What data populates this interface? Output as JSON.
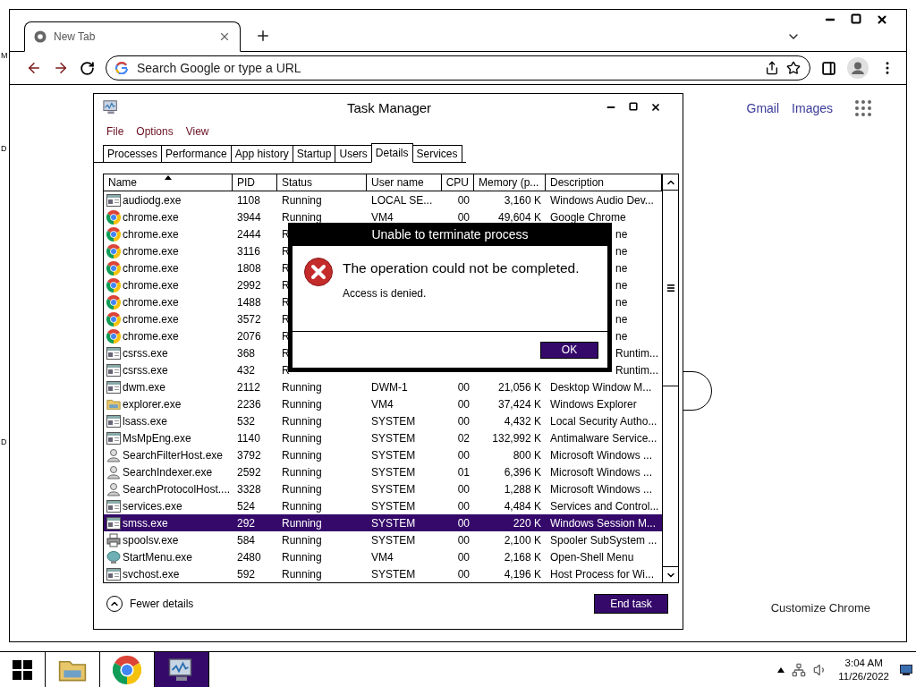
{
  "desktop": {
    "labels": [
      "M",
      "D",
      "D"
    ]
  },
  "browser": {
    "tabs": [
      {
        "title": "New Tab",
        "selected": true
      }
    ],
    "omnibox": {
      "placeholder": "Search Google or type a URL"
    },
    "links": [
      "Gmail",
      "Images"
    ],
    "customize": "Customize Chrome"
  },
  "task_manager": {
    "title": "Task Manager",
    "menu": [
      "File",
      "Options",
      "View"
    ],
    "tabs": [
      {
        "label": "Processes",
        "selected": false
      },
      {
        "label": "Performance",
        "selected": false
      },
      {
        "label": "App history",
        "selected": false
      },
      {
        "label": "Startup",
        "selected": false
      },
      {
        "label": "Users",
        "selected": false
      },
      {
        "label": "Details",
        "selected": true
      },
      {
        "label": "Services",
        "selected": false
      }
    ],
    "columns": [
      {
        "label": "Name",
        "sorted": true
      },
      {
        "label": "PID",
        "sorted": false
      },
      {
        "label": "Status",
        "sorted": false
      },
      {
        "label": "User name",
        "sorted": false
      },
      {
        "label": "CPU",
        "sorted": false
      },
      {
        "label": "Memory (p...",
        "sorted": false
      },
      {
        "label": "Description",
        "sorted": false
      }
    ],
    "rows": [
      {
        "kind": "exe",
        "name": "audiodg.exe",
        "pid": "1108",
        "status": "Running",
        "user": "LOCAL SE...",
        "cpu": "00",
        "memory": "3,160 K",
        "description": "Windows Audio Dev...",
        "selected": false,
        "covered": false
      },
      {
        "kind": "chrome",
        "name": "chrome.exe",
        "pid": "3944",
        "status": "Running",
        "user": "VM4",
        "cpu": "00",
        "memory": "49,604 K",
        "description": "Google Chrome",
        "selected": false,
        "covered": false
      },
      {
        "kind": "chrome",
        "name": "chrome.exe",
        "pid": "2444",
        "status": "R",
        "description": "ne",
        "selected": false,
        "covered": true
      },
      {
        "kind": "chrome",
        "name": "chrome.exe",
        "pid": "3116",
        "status": "R",
        "description": "ne",
        "selected": false,
        "covered": true
      },
      {
        "kind": "chrome",
        "name": "chrome.exe",
        "pid": "1808",
        "status": "R",
        "description": "ne",
        "selected": false,
        "covered": true
      },
      {
        "kind": "chrome",
        "name": "chrome.exe",
        "pid": "2992",
        "status": "R",
        "description": "ne",
        "selected": false,
        "covered": true
      },
      {
        "kind": "chrome",
        "name": "chrome.exe",
        "pid": "1488",
        "status": "R",
        "description": "ne",
        "selected": false,
        "covered": true
      },
      {
        "kind": "chrome",
        "name": "chrome.exe",
        "pid": "3572",
        "status": "R",
        "description": "ne",
        "selected": false,
        "covered": true
      },
      {
        "kind": "chrome",
        "name": "chrome.exe",
        "pid": "2076",
        "status": "R",
        "description": "ne",
        "selected": false,
        "covered": true
      },
      {
        "kind": "exe",
        "name": "csrss.exe",
        "pid": "368",
        "status": "R",
        "description": "Runtim...",
        "selected": false,
        "covered": true
      },
      {
        "kind": "exe",
        "name": "csrss.exe",
        "pid": "432",
        "status": "R",
        "description": "Runtim...",
        "selected": false,
        "covered": true
      },
      {
        "kind": "exe",
        "name": "dwm.exe",
        "pid": "2112",
        "status": "Running",
        "user": "DWM-1",
        "cpu": "00",
        "memory": "21,056 K",
        "description": "Desktop Window M...",
        "selected": false,
        "covered": false
      },
      {
        "kind": "folder",
        "name": "explorer.exe",
        "pid": "2236",
        "status": "Running",
        "user": "VM4",
        "cpu": "00",
        "memory": "37,424 K",
        "description": "Windows Explorer",
        "selected": false,
        "covered": false
      },
      {
        "kind": "exe",
        "name": "lsass.exe",
        "pid": "532",
        "status": "Running",
        "user": "SYSTEM",
        "cpu": "00",
        "memory": "4,432 K",
        "description": "Local Security Autho...",
        "selected": false,
        "covered": false
      },
      {
        "kind": "exe",
        "name": "MsMpEng.exe",
        "pid": "1140",
        "status": "Running",
        "user": "SYSTEM",
        "cpu": "02",
        "memory": "132,992 K",
        "description": "Antimalware Service...",
        "selected": false,
        "covered": false
      },
      {
        "kind": "search",
        "name": "SearchFilterHost.exe",
        "pid": "3792",
        "status": "Running",
        "user": "SYSTEM",
        "cpu": "00",
        "memory": "800 K",
        "description": "Microsoft Windows ...",
        "selected": false,
        "covered": false
      },
      {
        "kind": "search",
        "name": "SearchIndexer.exe",
        "pid": "2592",
        "status": "Running",
        "user": "SYSTEM",
        "cpu": "01",
        "memory": "6,396 K",
        "description": "Microsoft Windows ...",
        "selected": false,
        "covered": false
      },
      {
        "kind": "search",
        "name": "SearchProtocolHost....",
        "pid": "3328",
        "status": "Running",
        "user": "SYSTEM",
        "cpu": "00",
        "memory": "1,288 K",
        "description": "Microsoft Windows ...",
        "selected": false,
        "covered": false
      },
      {
        "kind": "exe",
        "name": "services.exe",
        "pid": "524",
        "status": "Running",
        "user": "SYSTEM",
        "cpu": "00",
        "memory": "4,484 K",
        "description": "Services and Control...",
        "selected": false,
        "covered": false
      },
      {
        "kind": "exe",
        "name": "smss.exe",
        "pid": "292",
        "status": "Running",
        "user": "SYSTEM",
        "cpu": "00",
        "memory": "220 K",
        "description": "Windows Session M...",
        "selected": true,
        "covered": false
      },
      {
        "kind": "printer",
        "name": "spoolsv.exe",
        "pid": "584",
        "status": "Running",
        "user": "SYSTEM",
        "cpu": "00",
        "memory": "2,100 K",
        "description": "Spooler SubSystem ...",
        "selected": false,
        "covered": false
      },
      {
        "kind": "shell",
        "name": "StartMenu.exe",
        "pid": "2480",
        "status": "Running",
        "user": "VM4",
        "cpu": "00",
        "memory": "2,168 K",
        "description": "Open-Shell Menu",
        "selected": false,
        "covered": false
      },
      {
        "kind": "exe",
        "name": "svchost.exe",
        "pid": "592",
        "status": "Running",
        "user": "SYSTEM",
        "cpu": "00",
        "memory": "4,196 K",
        "description": "Host Process for Wi...",
        "selected": false,
        "covered": false
      }
    ],
    "fewer_details": "Fewer details",
    "end_task": "End task",
    "dialog": {
      "title": "Unable to terminate process",
      "message": "The operation could not be completed.",
      "detail": "Access is denied.",
      "button": "OK"
    }
  },
  "taskbar": {
    "apps": [
      {
        "kind": "explorer",
        "active": false
      },
      {
        "kind": "chrome",
        "active": false
      },
      {
        "kind": "taskmgr",
        "active": true
      }
    ],
    "time": "3:04 AM",
    "date": "11/26/2022"
  }
}
